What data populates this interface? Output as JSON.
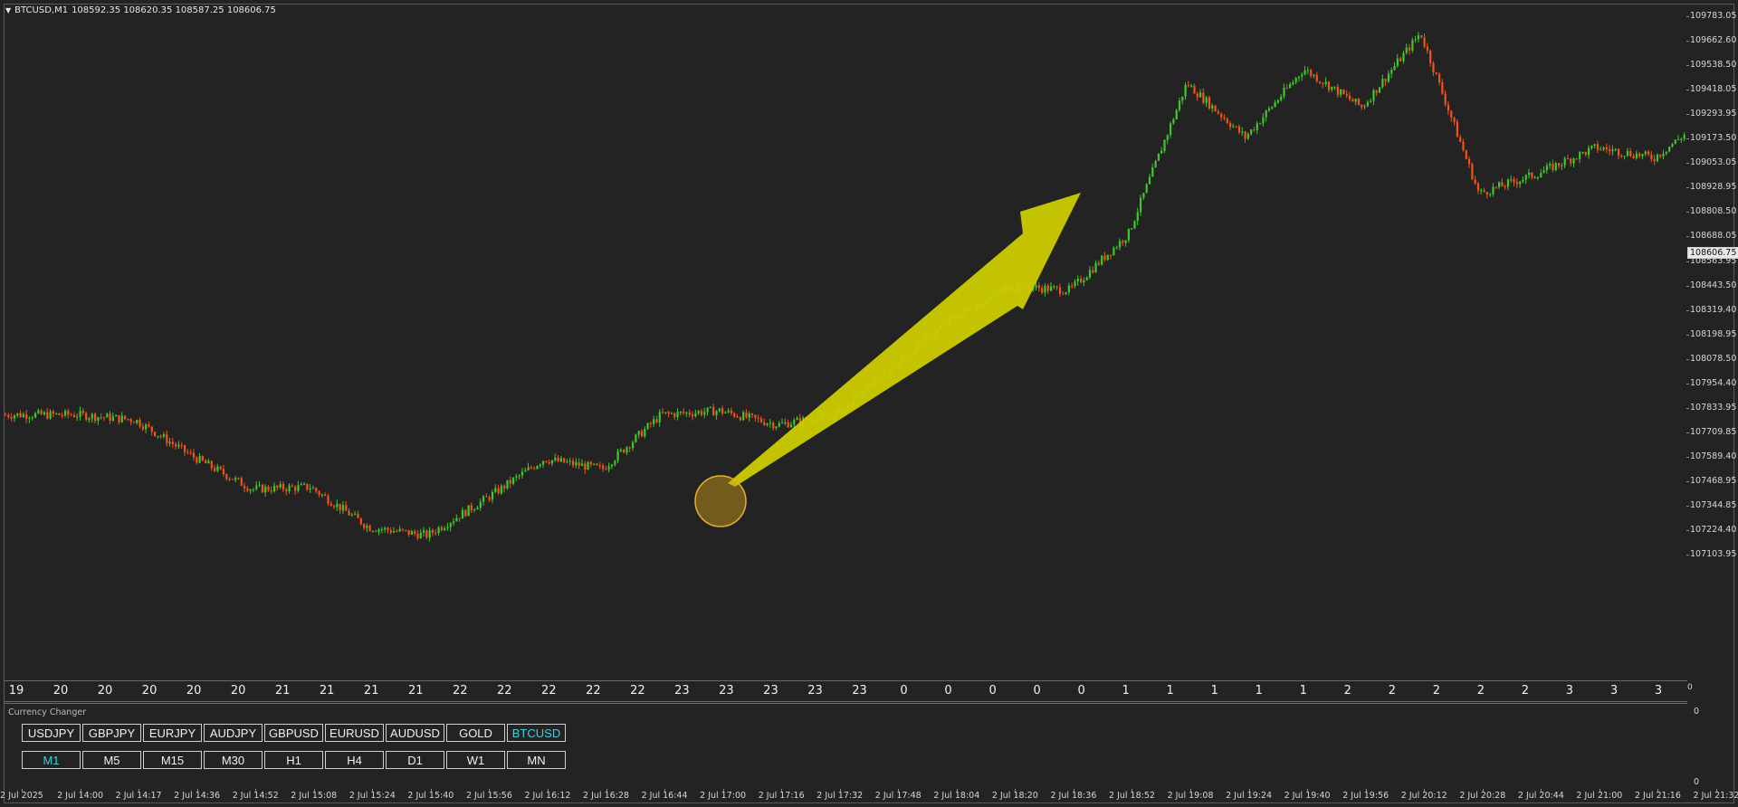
{
  "header": {
    "symbol_tf": "BTCUSD,M1",
    "ohlc": "108592.35 108620.35 108587.25 108606.75"
  },
  "price_axis": {
    "labels": [
      "109783.05",
      "109662.60",
      "109538.50",
      "109418.05",
      "109293.95",
      "109173.50",
      "109053.05",
      "108928.95",
      "108808.50",
      "108688.05",
      "108563.95",
      "108443.50",
      "108319.40",
      "108198.95",
      "108078.50",
      "107954.40",
      "107833.95",
      "107709.85",
      "107589.40",
      "107468.95",
      "107344.85",
      "107224.40",
      "107103.95"
    ],
    "current_price": "108606.75"
  },
  "hour_strip": [
    "19",
    "20",
    "20",
    "20",
    "20",
    "20",
    "21",
    "21",
    "21",
    "21",
    "22",
    "22",
    "22",
    "22",
    "22",
    "23",
    "23",
    "23",
    "23",
    "23",
    "0",
    "0",
    "0",
    "0",
    "0",
    "1",
    "1",
    "1",
    "1",
    "1",
    "2",
    "2",
    "2",
    "2",
    "2",
    "3",
    "3",
    "3"
  ],
  "scroll_marker": "0",
  "subwindow": {
    "title": "Currency Changer",
    "axis_top": "0",
    "axis_bottom": "0",
    "symbols": [
      "USDJPY",
      "GBPJPY",
      "EURJPY",
      "AUDJPY",
      "GBPUSD",
      "EURUSD",
      "AUDUSD",
      "GOLD",
      "BTCUSD"
    ],
    "active_symbol": "BTCUSD",
    "timeframes": [
      "M1",
      "M5",
      "M15",
      "M30",
      "H1",
      "H4",
      "D1",
      "W1",
      "MN"
    ],
    "active_timeframe": "M1"
  },
  "time_axis": [
    "2 Jul 2025",
    "2 Jul 14:00",
    "2 Jul 14:17",
    "2 Jul 14:36",
    "2 Jul 14:52",
    "2 Jul 15:08",
    "2 Jul 15:24",
    "2 Jul 15:40",
    "2 Jul 15:56",
    "2 Jul 16:12",
    "2 Jul 16:28",
    "2 Jul 16:44",
    "2 Jul 17:00",
    "2 Jul 17:16",
    "2 Jul 17:32",
    "2 Jul 17:48",
    "2 Jul 18:04",
    "2 Jul 18:20",
    "2 Jul 18:36",
    "2 Jul 18:52",
    "2 Jul 19:08",
    "2 Jul 19:24",
    "2 Jul 19:40",
    "2 Jul 19:56",
    "2 Jul 20:12",
    "2 Jul 20:28",
    "2 Jul 20:44",
    "2 Jul 21:00",
    "2 Jul 21:16",
    "2 Jul 21:32"
  ],
  "colors": {
    "background": "#232323",
    "bull": "#3fc82e",
    "bear": "#f0541a",
    "arrow": "#cccc00",
    "highlight": "#d4a017",
    "active_button_text": "#3ed0e0"
  },
  "chart_data": {
    "type": "candlestick",
    "symbol": "BTCUSD",
    "timeframe": "M1",
    "ylim": [
      107103.95,
      109783.05
    ],
    "path_anchors": [
      {
        "t": "2 Jul 14:00",
        "price": 107800
      },
      {
        "t": "2 Jul 14:17",
        "price": 107775
      },
      {
        "t": "2 Jul 14:36",
        "price": 107590
      },
      {
        "t": "2 Jul 14:52",
        "price": 107430
      },
      {
        "t": "2 Jul 15:08",
        "price": 107440
      },
      {
        "t": "2 Jul 15:24",
        "price": 107240
      },
      {
        "t": "2 Jul 15:40",
        "price": 107200
      },
      {
        "t": "2 Jul 15:56",
        "price": 107380
      },
      {
        "t": "2 Jul 16:12",
        "price": 107580
      },
      {
        "t": "2 Jul 16:28",
        "price": 107530
      },
      {
        "t": "2 Jul 16:44",
        "price": 107800
      },
      {
        "t": "2 Jul 17:00",
        "price": 107820
      },
      {
        "t": "2 Jul 17:16",
        "price": 107750
      },
      {
        "t": "2 Jul 17:32",
        "price": 107800
      },
      {
        "t": "2 Jul 17:48",
        "price": 108050
      },
      {
        "t": "2 Jul 18:04",
        "price": 108280
      },
      {
        "t": "2 Jul 18:20",
        "price": 108440
      },
      {
        "t": "2 Jul 18:36",
        "price": 108420
      },
      {
        "t": "2 Jul 18:52",
        "price": 108700
      },
      {
        "t": "2 Jul 19:08",
        "price": 109450
      },
      {
        "t": "2 Jul 19:24",
        "price": 109180
      },
      {
        "t": "2 Jul 19:40",
        "price": 109520
      },
      {
        "t": "2 Jul 19:56",
        "price": 109330
      },
      {
        "t": "2 Jul 20:12",
        "price": 109700
      },
      {
        "t": "2 Jul 20:28",
        "price": 108900
      },
      {
        "t": "2 Jul 20:44",
        "price": 109000
      },
      {
        "t": "2 Jul 21:00",
        "price": 109130
      },
      {
        "t": "2 Jul 21:16",
        "price": 109080
      },
      {
        "t": "2 Jul 21:32",
        "price": 109300
      }
    ]
  }
}
